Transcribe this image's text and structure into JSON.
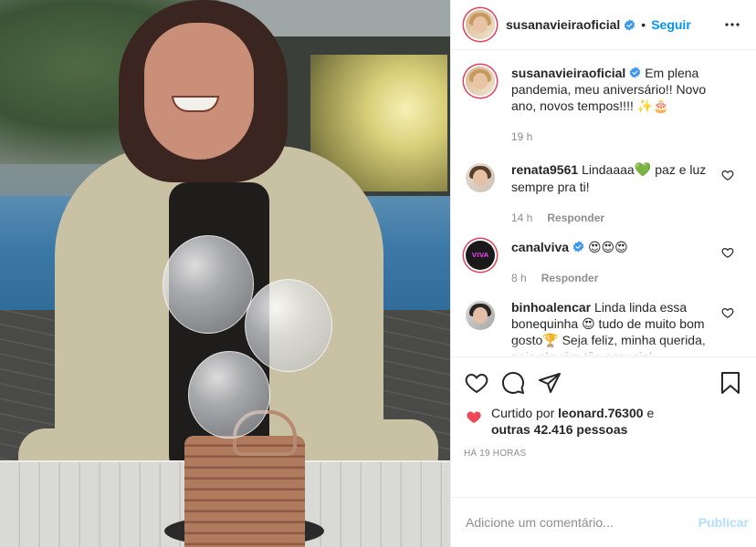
{
  "post": {
    "author": "susanavieiraoficial",
    "verified": true,
    "follow_label": "Seguir",
    "more_icon": "more-horizontal-icon"
  },
  "caption": {
    "user": "susanavieiraoficial",
    "text": "Em plena pandemia, meu aniversário!! Novo ano, novos tempos!!!! ✨🎂",
    "time": "19 h"
  },
  "comments": [
    {
      "user": "renata9561",
      "text_before": "Lindaaaa",
      "emoji": "💚",
      "text_after": " paz e luz sempre pra ti!",
      "time": "14 h",
      "reply_label": "Responder"
    },
    {
      "user": "canalviva",
      "avatar_text": "VIVA",
      "text": "😍😍😍",
      "time": "8 h",
      "reply_label": "Responder"
    },
    {
      "user": "binhoalencar",
      "text": "Linda linda essa bonequinha 😍 tudo de muito bom gosto🏆 Seja feliz, minha querida, pois alguém tão especial"
    }
  ],
  "likes": {
    "prefix": "Curtido por",
    "user": "leonard.76300",
    "conj": "e",
    "others": "outras 42.416 pessoas"
  },
  "timestamp": "HÁ 19 HORAS",
  "add_comment": {
    "placeholder": "Adicione um comentário...",
    "publish_label": "Publicar"
  },
  "colors": {
    "link_blue": "#0095f6",
    "publish_disabled": "#b2dffc",
    "like_red": "#ed4956",
    "verified_blue": "#3897f0"
  }
}
